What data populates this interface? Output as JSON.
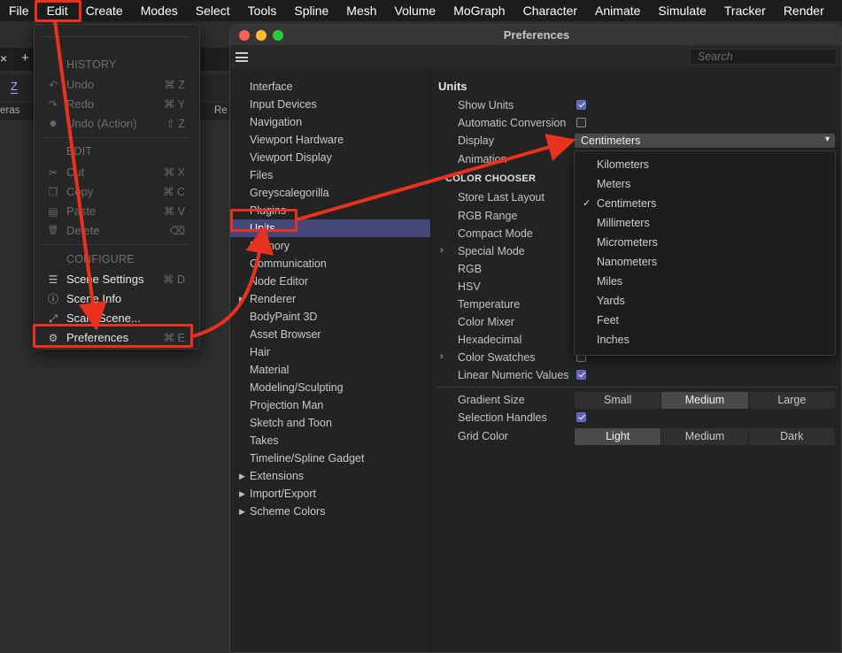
{
  "menubar": {
    "items": [
      "File",
      "Edit",
      "Create",
      "Modes",
      "Select",
      "Tools",
      "Spline",
      "Mesh",
      "Volume",
      "MoGraph",
      "Character",
      "Animate",
      "Simulate",
      "Tracker",
      "Render",
      "Re"
    ]
  },
  "background": {
    "tab_close": "×",
    "tab_add": "+",
    "axis_label": "Z",
    "left_label": "eras",
    "right_label": "Re"
  },
  "edit_menu": {
    "history_header": "HISTORY",
    "undo": {
      "label": "Undo",
      "shortcut": "⌘ Z",
      "icon": "undo-icon",
      "glyph": "↶"
    },
    "redo": {
      "label": "Redo",
      "shortcut": "⌘ Y",
      "icon": "redo-icon",
      "glyph": "↷"
    },
    "undo_action": {
      "label": "Undo (Action)",
      "shortcut": "⇧ Z",
      "icon": "action-icon",
      "glyph": "✹"
    },
    "edit_header": "EDIT",
    "cut": {
      "label": "Cut",
      "shortcut": "⌘ X",
      "icon": "scissors-icon",
      "glyph": "✂"
    },
    "copy": {
      "label": "Copy",
      "shortcut": "⌘ C",
      "icon": "copy-icon",
      "glyph": "❐"
    },
    "paste": {
      "label": "Paste",
      "shortcut": "⌘ V",
      "icon": "paste-icon",
      "glyph": "▤"
    },
    "delete": {
      "label": "Delete",
      "shortcut": "⌫",
      "icon": "trash-icon",
      "glyph": "🗑"
    },
    "configure_header": "CONFIGURE",
    "scene_settings": {
      "label": "Scene Settings",
      "shortcut": "⌘ D",
      "icon": "scene-settings-icon",
      "glyph": "☰"
    },
    "scene_info": {
      "label": "Scene Info",
      "shortcut": "",
      "icon": "info-icon",
      "glyph": "ⓘ"
    },
    "scale_scene": {
      "label": "Scale Scene...",
      "shortcut": "",
      "icon": "scale-icon",
      "glyph": "⤢"
    },
    "preferences": {
      "label": "Preferences",
      "shortcut": "⌘ E",
      "icon": "gear-icon",
      "glyph": "⚙"
    }
  },
  "preferences": {
    "title": "Preferences",
    "search_placeholder": "Search",
    "sidebar": [
      {
        "label": "Interface",
        "arrow": false
      },
      {
        "label": "Input Devices",
        "arrow": false
      },
      {
        "label": "Navigation",
        "arrow": false
      },
      {
        "label": "Viewport Hardware",
        "arrow": false
      },
      {
        "label": "Viewport Display",
        "arrow": false
      },
      {
        "label": "Files",
        "arrow": false
      },
      {
        "label": "Greyscalegorilla",
        "arrow": false
      },
      {
        "label": "Plugins",
        "arrow": false
      },
      {
        "label": "Units",
        "arrow": false,
        "selected": true
      },
      {
        "label": "Memory",
        "arrow": false
      },
      {
        "label": "Communication",
        "arrow": false
      },
      {
        "label": "Node Editor",
        "arrow": false
      },
      {
        "label": "Renderer",
        "arrow": true
      },
      {
        "label": "BodyPaint 3D",
        "arrow": false
      },
      {
        "label": "Asset Browser",
        "arrow": false
      },
      {
        "label": "Hair",
        "arrow": false
      },
      {
        "label": "Material",
        "arrow": false
      },
      {
        "label": "Modeling/Sculpting",
        "arrow": false
      },
      {
        "label": "Projection Man",
        "arrow": false
      },
      {
        "label": "Sketch and Toon",
        "arrow": false
      },
      {
        "label": "Takes",
        "arrow": false
      },
      {
        "label": "Timeline/Spline Gadget",
        "arrow": false
      },
      {
        "label": "Extensions",
        "arrow": true
      },
      {
        "label": "Import/Export",
        "arrow": true
      },
      {
        "label": "Scheme Colors",
        "arrow": true
      }
    ],
    "units": {
      "section_title": "Units",
      "show_units": {
        "label": "Show Units",
        "checked": true
      },
      "automatic_conversion": {
        "label": "Automatic Conversion",
        "checked": false
      },
      "display_label": "Display",
      "display_value": "Centimeters",
      "animation_label": "Animation",
      "color_chooser_header": "COLOR CHOOSER",
      "store_last_layout": "Store Last Layout",
      "rgb_range": "RGB Range",
      "compact_mode": "Compact Mode",
      "special_mode": "Special Mode",
      "rgb": "RGB",
      "hsv": "HSV",
      "temperature": "Temperature",
      "color_mixer": "Color Mixer",
      "hexadecimal": "Hexadecimal",
      "color_swatches": {
        "label": "Color Swatches",
        "checked": false
      },
      "linear_numeric": {
        "label": "Linear Numeric Values",
        "checked": true
      },
      "gradient_size": {
        "label": "Gradient Size",
        "options": [
          "Small",
          "Medium",
          "Large"
        ],
        "selected": "Medium"
      },
      "selection_handles": {
        "label": "Selection Handles",
        "checked": true
      },
      "grid_color": {
        "label": "Grid Color",
        "options": [
          "Light",
          "Medium",
          "Dark"
        ],
        "selected": "Light"
      }
    },
    "display_options": [
      "Kilometers",
      "Meters",
      "Centimeters",
      "Millimeters",
      "Micrometers",
      "Nanometers",
      "Miles",
      "Yards",
      "Feet",
      "Inches"
    ],
    "display_selected": "Centimeters",
    "dropdown_caret": "▾",
    "chevron": "›"
  },
  "colors": {
    "annotation": "#e8321f",
    "selection": "#45477a",
    "checkbox": "#5b60b8"
  }
}
